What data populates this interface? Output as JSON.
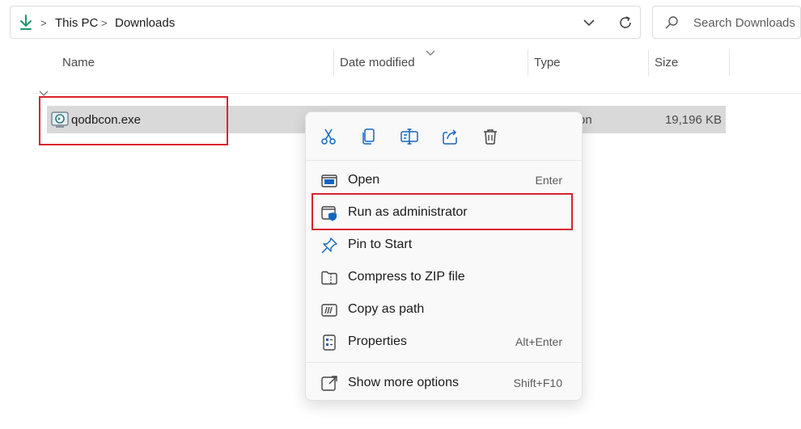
{
  "address_bar": {
    "icon": "download-arrow-icon",
    "breadcrumbs": [
      "This PC",
      "Downloads"
    ],
    "accent": "#1a9a6a"
  },
  "search": {
    "placeholder": "Search Downloads"
  },
  "columns": {
    "name": "Name",
    "date_modified": "Date modified",
    "type": "Type",
    "size": "Size"
  },
  "files": [
    {
      "name": "qodbcon.exe",
      "type_visible": "on",
      "size": "19,196 KB",
      "icon": "application-exe-icon"
    }
  ],
  "context_menu": {
    "toolbar": [
      "cut-icon",
      "copy-icon",
      "rename-icon",
      "share-icon",
      "delete-icon"
    ],
    "items": [
      {
        "label": "Open",
        "shortcut": "Enter",
        "icon": "open-window-icon"
      },
      {
        "label": "Run as administrator",
        "shortcut": "",
        "icon": "shield-admin-icon"
      },
      {
        "label": "Pin to Start",
        "shortcut": "",
        "icon": "pin-icon"
      },
      {
        "label": "Compress to ZIP file",
        "shortcut": "",
        "icon": "zip-folder-icon"
      },
      {
        "label": "Copy as path",
        "shortcut": "",
        "icon": "copy-path-icon"
      },
      {
        "label": "Properties",
        "shortcut": "Alt+Enter",
        "icon": "properties-icon"
      },
      {
        "label": "Show more options",
        "shortcut": "Shift+F10",
        "icon": "more-options-icon"
      }
    ]
  },
  "colors": {
    "highlight_border": "#d9232b",
    "selection": "#d9d9d9",
    "icon_blue": "#1565c0"
  }
}
